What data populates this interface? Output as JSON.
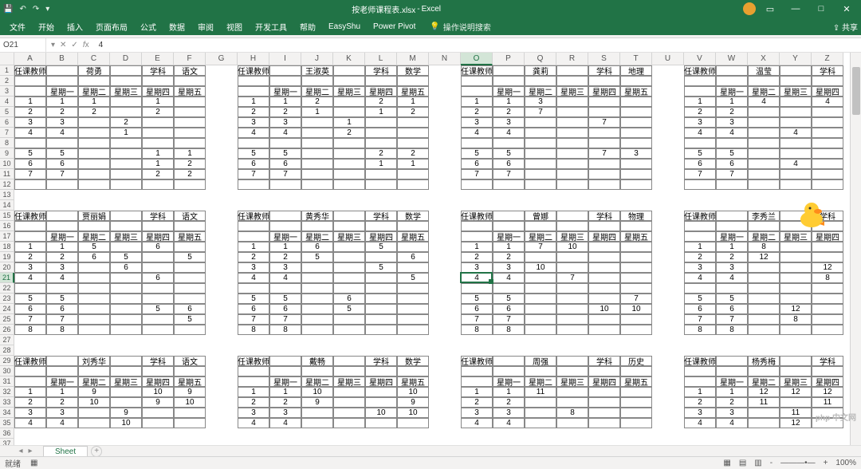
{
  "window": {
    "filename": "按老师课程表.xlsx",
    "app": "Excel"
  },
  "qat": {
    "save": "💾",
    "undo": "↶",
    "redo": "↷",
    "more": "▾"
  },
  "tabs": [
    "文件",
    "开始",
    "插入",
    "页面布局",
    "公式",
    "数据",
    "审阅",
    "视图",
    "开发工具",
    "帮助",
    "EasyShu",
    "Power Pivot"
  ],
  "tell_me": "操作说明搜索",
  "share": "共享",
  "name_box": "O21",
  "formula_value": "4",
  "columns": [
    "A",
    "B",
    "C",
    "D",
    "E",
    "F",
    "G",
    "H",
    "I",
    "J",
    "K",
    "L",
    "M",
    "N",
    "O",
    "P",
    "Q",
    "R",
    "S",
    "T",
    "U",
    "V",
    "W",
    "X",
    "Y",
    "Z"
  ],
  "row_count": 37,
  "active_cell": {
    "col": 14,
    "row": 20
  },
  "blocks": [
    {
      "c": 0,
      "r": 0,
      "header": {
        "label1": "任课教师",
        "teacher": "荷勇",
        "label2": "学科",
        "subject": "语文"
      },
      "days": [
        "星期一",
        "星期二",
        "星期三",
        "星期四",
        "星期五"
      ],
      "rows": [
        [
          "1",
          "1",
          "",
          "1",
          ""
        ],
        [
          "2",
          "2",
          "",
          "2",
          ""
        ],
        [
          "3",
          "",
          "2",
          "",
          ""
        ],
        [
          "4",
          "",
          "1",
          "",
          ""
        ],
        [
          "",
          "",
          "",
          "",
          ""
        ],
        [
          "5",
          "",
          "",
          "1",
          "1"
        ],
        [
          "6",
          "",
          "",
          "1",
          "2"
        ],
        [
          "7",
          "",
          "",
          "2",
          "2"
        ],
        [
          "",
          "",
          "",
          "",
          ""
        ]
      ],
      "keys": [
        "1",
        "2",
        "3",
        "4",
        "",
        "5",
        "6",
        "7",
        ""
      ]
    },
    {
      "c": 7,
      "r": 0,
      "header": {
        "label1": "任课教师",
        "teacher": "王淑英",
        "label2": "学科",
        "subject": "数学"
      },
      "days": [
        "星期一",
        "星期二",
        "星期三",
        "星期四",
        "星期五"
      ],
      "rows": [
        [
          "1",
          "2",
          "",
          "2",
          "1"
        ],
        [
          "2",
          "1",
          "",
          "1",
          "2"
        ],
        [
          "3",
          "",
          "1",
          "",
          "",
          "2"
        ],
        [
          "4",
          "",
          "2",
          "",
          "",
          "1"
        ],
        [
          "",
          "",
          "",
          "",
          ""
        ],
        [
          "5",
          "",
          "",
          "2",
          "2"
        ],
        [
          "6",
          "",
          "",
          "1",
          "1"
        ],
        [
          "7",
          "",
          "",
          "",
          ""
        ],
        [
          "",
          "",
          "",
          "",
          ""
        ]
      ],
      "keys": [
        "1",
        "2",
        "3",
        "4",
        "",
        "5",
        "6",
        "7",
        ""
      ]
    },
    {
      "c": 14,
      "r": 0,
      "header": {
        "label1": "任课教师",
        "teacher": "龚莉",
        "label2": "学科",
        "subject": "地理"
      },
      "days": [
        "星期一",
        "星期二",
        "星期三",
        "星期四",
        "星期五"
      ],
      "rows": [
        [
          "1",
          "3",
          "",
          "",
          "",
          ""
        ],
        [
          "2",
          "7",
          "",
          "",
          "",
          "3"
        ],
        [
          "3",
          "",
          "",
          "7",
          "",
          "7"
        ],
        [
          "4",
          "",
          "",
          "",
          "",
          ""
        ],
        [
          "",
          "",
          "",
          "",
          ""
        ],
        [
          "5",
          "",
          "",
          "7",
          "3",
          ""
        ],
        [
          "6",
          "",
          "",
          "",
          "",
          ""
        ],
        [
          "7",
          "",
          "",
          "",
          "",
          ""
        ],
        [
          "",
          "",
          "",
          "",
          ""
        ]
      ],
      "keys": [
        "1",
        "2",
        "3",
        "4",
        "",
        "5",
        "6",
        "7",
        ""
      ]
    },
    {
      "c": 21,
      "r": 0,
      "header": {
        "label1": "任课教师",
        "teacher": "温莹",
        "label2": "学科"
      },
      "days": [
        "星期一",
        "星期二",
        "星期三",
        "星期四"
      ],
      "rows": [
        [
          "1",
          "4",
          "",
          "4",
          "4"
        ],
        [
          "2",
          "",
          "",
          "",
          ""
        ],
        [
          "3",
          "",
          "",
          "",
          ""
        ],
        [
          "4",
          "",
          "4",
          "",
          ""
        ],
        [
          "",
          "",
          "",
          "",
          ""
        ],
        [
          "5",
          "",
          "",
          "",
          ""
        ],
        [
          "6",
          "",
          "4",
          "",
          ""
        ],
        [
          "7",
          "",
          "",
          "",
          ""
        ],
        [
          "",
          "",
          "",
          "",
          ""
        ]
      ],
      "keys": [
        "1",
        "2",
        "3",
        "4",
        "",
        "5",
        "6",
        "7",
        ""
      ]
    },
    {
      "c": 0,
      "r": 14,
      "header": {
        "label1": "任课教师",
        "teacher": "贾丽娟",
        "label2": "学科",
        "subject": "语文"
      },
      "days": [
        "星期一",
        "星期二",
        "星期三",
        "星期四",
        "星期五"
      ],
      "rows": [
        [
          "1",
          "5",
          "",
          "6",
          "",
          ""
        ],
        [
          "2",
          "6",
          "5",
          "",
          "5",
          ""
        ],
        [
          "3",
          "",
          "6",
          "",
          "",
          ""
        ],
        [
          "4",
          "",
          "",
          "6",
          "",
          ""
        ],
        [
          "",
          "",
          "",
          "",
          ""
        ],
        [
          "5",
          "",
          "",
          "",
          "",
          ""
        ],
        [
          "6",
          "",
          "",
          "5",
          "6",
          ""
        ],
        [
          "7",
          "",
          "",
          "",
          "5",
          ""
        ],
        [
          "8",
          "",
          "",
          "",
          "",
          ""
        ]
      ],
      "keys": [
        "1",
        "2",
        "3",
        "4",
        "",
        "5",
        "6",
        "7",
        "8"
      ]
    },
    {
      "c": 7,
      "r": 14,
      "header": {
        "label1": "任课教师",
        "teacher": "黄秀华",
        "label2": "学科",
        "subject": "数学"
      },
      "days": [
        "星期一",
        "星期二",
        "星期三",
        "星期四",
        "星期五"
      ],
      "rows": [
        [
          "1",
          "6",
          "",
          "5",
          "",
          "5"
        ],
        [
          "2",
          "5",
          "",
          "",
          "6",
          "6"
        ],
        [
          "3",
          "",
          "",
          "5",
          "",
          ""
        ],
        [
          "4",
          "",
          "",
          "",
          "5",
          ""
        ],
        [
          "",
          "",
          "",
          "",
          ""
        ],
        [
          "5",
          "",
          "6",
          "",
          "",
          ""
        ],
        [
          "6",
          "",
          "5",
          "",
          "",
          ""
        ],
        [
          "7",
          "",
          "",
          "",
          "",
          ""
        ],
        [
          "8",
          "",
          "",
          "",
          "",
          ""
        ]
      ],
      "keys": [
        "1",
        "2",
        "3",
        "4",
        "",
        "5",
        "6",
        "7",
        "8"
      ]
    },
    {
      "c": 14,
      "r": 14,
      "header": {
        "label1": "任课教师",
        "teacher": "曾娜",
        "label2": "学科",
        "subject": "物理"
      },
      "days": [
        "星期一",
        "星期二",
        "星期三",
        "星期四",
        "星期五"
      ],
      "rows": [
        [
          "1",
          "7",
          "10",
          "",
          "",
          ""
        ],
        [
          "2",
          "",
          "",
          "",
          "",
          ""
        ],
        [
          "3",
          "10",
          "",
          "",
          "",
          ""
        ],
        [
          "4",
          "",
          "7",
          "",
          "",
          ""
        ],
        [
          "",
          "",
          "",
          "",
          ""
        ],
        [
          "5",
          "",
          "",
          "",
          "7",
          ""
        ],
        [
          "6",
          "",
          "",
          "10",
          "10",
          ""
        ],
        [
          "7",
          "",
          "",
          "",
          "",
          ""
        ],
        [
          "8",
          "",
          "",
          "",
          "",
          ""
        ]
      ],
      "keys": [
        "1",
        "2",
        "3",
        "4",
        "",
        "5",
        "6",
        "7",
        "8"
      ]
    },
    {
      "c": 21,
      "r": 14,
      "header": {
        "label1": "任课教师",
        "teacher": "李秀兰",
        "label2": "学科"
      },
      "days": [
        "星期一",
        "星期二",
        "星期三",
        "星期四"
      ],
      "rows": [
        [
          "1",
          "8",
          "",
          "",
          "12"
        ],
        [
          "2",
          "12",
          "",
          "",
          ""
        ],
        [
          "3",
          "",
          "",
          "12",
          ""
        ],
        [
          "4",
          "",
          "",
          "8",
          ""
        ],
        [
          "",
          "",
          "",
          "",
          ""
        ],
        [
          "5",
          "",
          "",
          "",
          ""
        ],
        [
          "6",
          "",
          "12",
          "",
          ""
        ],
        [
          "7",
          "",
          "8",
          "",
          ""
        ],
        [
          "8",
          "",
          "",
          "",
          ""
        ]
      ],
      "keys": [
        "1",
        "2",
        "3",
        "4",
        "",
        "5",
        "6",
        "7",
        "8"
      ]
    },
    {
      "c": 0,
      "r": 28,
      "header": {
        "label1": "任课教师",
        "teacher": "刘秀华",
        "label2": "学科",
        "subject": "语文"
      },
      "days": [
        "星期一",
        "星期二",
        "星期三",
        "星期四",
        "星期五"
      ],
      "rows": [
        [
          "1",
          "9",
          "",
          "10",
          "9",
          ""
        ],
        [
          "2",
          "10",
          "",
          "9",
          "10",
          ""
        ],
        [
          "3",
          "",
          "9",
          "",
          "",
          ""
        ],
        [
          "4",
          "",
          "10",
          "",
          "",
          ""
        ]
      ],
      "keys": [
        "1",
        "2",
        "3",
        "4"
      ]
    },
    {
      "c": 7,
      "r": 28,
      "header": {
        "label1": "任课教师",
        "teacher": "戴畅",
        "label2": "学科",
        "subject": "数学"
      },
      "days": [
        "星期一",
        "星期二",
        "星期三",
        "星期四",
        "星期五"
      ],
      "rows": [
        [
          "1",
          "10",
          "",
          "",
          "10",
          ""
        ],
        [
          "2",
          "9",
          "",
          "",
          "9",
          ""
        ],
        [
          "3",
          "",
          "",
          "10",
          "10",
          "10"
        ],
        [
          "4",
          "",
          "",
          "",
          "",
          ""
        ]
      ],
      "keys": [
        "1",
        "2",
        "3",
        "4"
      ]
    },
    {
      "c": 14,
      "r": 28,
      "header": {
        "label1": "任课教师",
        "teacher": "周强",
        "label2": "学科",
        "subject": "历史"
      },
      "days": [
        "星期一",
        "星期二",
        "星期三",
        "星期四",
        "星期五"
      ],
      "rows": [
        [
          "1",
          "11",
          "",
          "",
          "",
          ""
        ],
        [
          "2",
          "",
          "",
          "",
          "",
          ""
        ],
        [
          "3",
          "",
          "8",
          "",
          "",
          "8"
        ],
        [
          "4",
          "",
          "",
          "",
          "",
          ""
        ]
      ],
      "keys": [
        "1",
        "2",
        "3",
        "4"
      ]
    },
    {
      "c": 21,
      "r": 28,
      "header": {
        "label1": "任课教师",
        "teacher": "杨秀梅",
        "label2": "学科"
      },
      "days": [
        "星期一",
        "星期二",
        "星期三",
        "星期四"
      ],
      "rows": [
        [
          "1",
          "12",
          "12",
          "12",
          "11"
        ],
        [
          "2",
          "11",
          "",
          "11",
          "12"
        ],
        [
          "3",
          "",
          "11",
          "",
          ""
        ],
        [
          "4",
          "",
          "12",
          "",
          ""
        ]
      ],
      "keys": [
        "1",
        "2",
        "3",
        "4"
      ]
    }
  ],
  "sheet_tab": "Sheet",
  "status_text": "就绪",
  "zoom": "100%",
  "watermark": "php 中文网"
}
